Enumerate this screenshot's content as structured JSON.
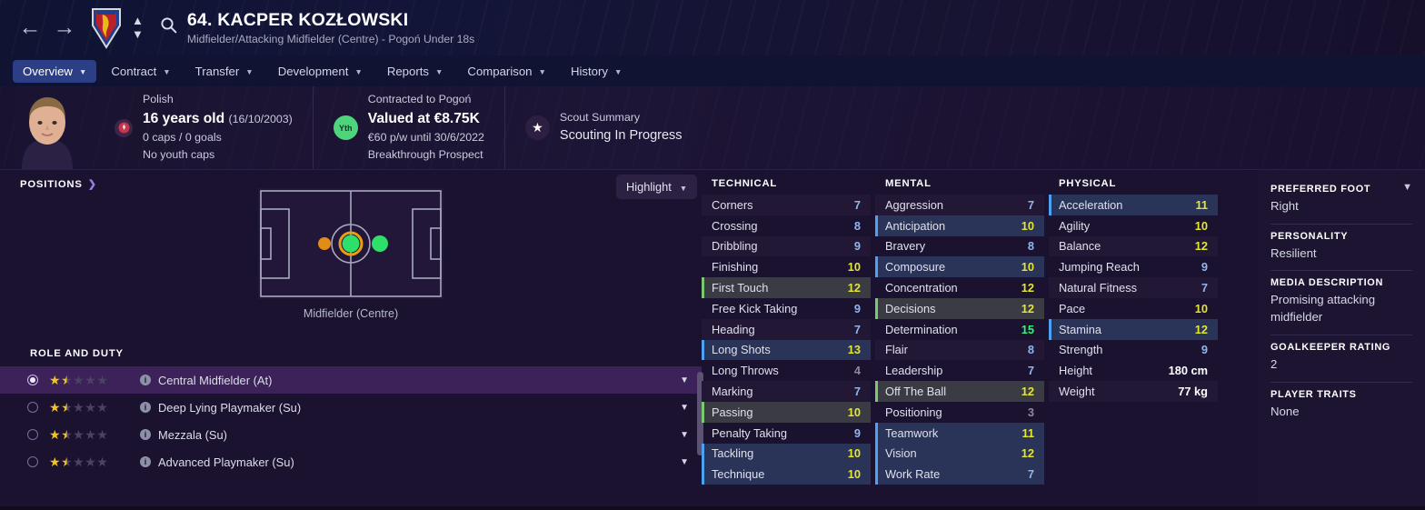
{
  "header": {
    "back_icon": "arrow-left-icon",
    "forward_icon": "arrow-right-icon",
    "club_crest": "pogon-szczecin-crest",
    "spinner_up": "chevron-up-icon",
    "spinner_down": "chevron-down-icon",
    "search_icon": "search-icon",
    "player_title": "64. KACPER KOZŁOWSKI",
    "player_subtitle": "Midfielder/Attacking Midfielder (Centre) - Pogoń Under 18s"
  },
  "tabs": [
    {
      "label": "Overview",
      "active": true
    },
    {
      "label": "Contract",
      "active": false
    },
    {
      "label": "Transfer",
      "active": false
    },
    {
      "label": "Development",
      "active": false
    },
    {
      "label": "Reports",
      "active": false
    },
    {
      "label": "Comparison",
      "active": false
    },
    {
      "label": "History",
      "active": false
    }
  ],
  "info": {
    "nationality": "Polish",
    "age": "16 years old",
    "dob": "(16/10/2003)",
    "caps": "0 caps / 0 goals",
    "youth_caps": "No youth caps",
    "contract_label": "Contracted to Pogoń",
    "value": "Valued at €8.75K",
    "wage": "€60 p/w until 30/6/2022",
    "status": "Breakthrough Prospect",
    "yth_badge": "Yth",
    "scout_label": "Scout Summary",
    "scout_value": "Scouting In Progress"
  },
  "positions": {
    "header": "POSITIONS",
    "header_arrow": "chevron-right-icon",
    "highlight_button": "Highlight",
    "pitch_caption": "Midfielder (Centre)",
    "markers": [
      {
        "name": "defensive-midfielder-marker",
        "color": "#e08c16",
        "selected": false
      },
      {
        "name": "midfielder-centre-marker",
        "color": "#2ee06a",
        "selected": true
      },
      {
        "name": "attacking-midfielder-marker",
        "color": "#2ee06a",
        "selected": false
      }
    ]
  },
  "role_and_duty": {
    "title": "ROLE AND DUTY",
    "roles": [
      {
        "name": "Central Midfielder (At)",
        "stars": 1.5,
        "selected": true
      },
      {
        "name": "Deep Lying Playmaker (Su)",
        "stars": 1.5,
        "selected": false
      },
      {
        "name": "Mezzala (Su)",
        "stars": 1.5,
        "selected": false
      },
      {
        "name": "Advanced Playmaker (Su)",
        "stars": 1.5,
        "selected": false
      }
    ]
  },
  "attributes": {
    "technical": {
      "header": "TECHNICAL",
      "rows": [
        {
          "name": "Corners",
          "value": "7",
          "tier": "mid",
          "bar": "none",
          "bg": "alt"
        },
        {
          "name": "Crossing",
          "value": "8",
          "tier": "mid",
          "bar": "none",
          "bg": "none"
        },
        {
          "name": "Dribbling",
          "value": "9",
          "tier": "mid",
          "bar": "none",
          "bg": "alt"
        },
        {
          "name": "Finishing",
          "value": "10",
          "tier": "good",
          "bar": "none",
          "bg": "none"
        },
        {
          "name": "First Touch",
          "value": "12",
          "tier": "good",
          "bar": "green",
          "bg": "grey"
        },
        {
          "name": "Free Kick Taking",
          "value": "9",
          "tier": "mid",
          "bar": "none",
          "bg": "none"
        },
        {
          "name": "Heading",
          "value": "7",
          "tier": "mid",
          "bar": "none",
          "bg": "alt"
        },
        {
          "name": "Long Shots",
          "value": "13",
          "tier": "good",
          "bar": "blue",
          "bg": "blue"
        },
        {
          "name": "Long Throws",
          "value": "4",
          "tier": "low",
          "bar": "none",
          "bg": "none"
        },
        {
          "name": "Marking",
          "value": "7",
          "tier": "mid",
          "bar": "none",
          "bg": "alt"
        },
        {
          "name": "Passing",
          "value": "10",
          "tier": "good",
          "bar": "green",
          "bg": "grey"
        },
        {
          "name": "Penalty Taking",
          "value": "9",
          "tier": "mid",
          "bar": "none",
          "bg": "none"
        },
        {
          "name": "Tackling",
          "value": "10",
          "tier": "good",
          "bar": "blue",
          "bg": "blue"
        },
        {
          "name": "Technique",
          "value": "10",
          "tier": "good",
          "bar": "blue",
          "bg": "blue"
        }
      ]
    },
    "mental": {
      "header": "MENTAL",
      "rows": [
        {
          "name": "Aggression",
          "value": "7",
          "tier": "mid",
          "bar": "none",
          "bg": "alt"
        },
        {
          "name": "Anticipation",
          "value": "10",
          "tier": "good",
          "bar": "blue",
          "bg": "blue"
        },
        {
          "name": "Bravery",
          "value": "8",
          "tier": "mid",
          "bar": "none",
          "bg": "none"
        },
        {
          "name": "Composure",
          "value": "10",
          "tier": "good",
          "bar": "blue",
          "bg": "blue"
        },
        {
          "name": "Concentration",
          "value": "12",
          "tier": "good",
          "bar": "none",
          "bg": "none"
        },
        {
          "name": "Decisions",
          "value": "12",
          "tier": "good",
          "bar": "green",
          "bg": "grey"
        },
        {
          "name": "Determination",
          "value": "15",
          "tier": "hi",
          "bar": "none",
          "bg": "none"
        },
        {
          "name": "Flair",
          "value": "8",
          "tier": "mid",
          "bar": "none",
          "bg": "alt"
        },
        {
          "name": "Leadership",
          "value": "7",
          "tier": "mid",
          "bar": "none",
          "bg": "none"
        },
        {
          "name": "Off The Ball",
          "value": "12",
          "tier": "good",
          "bar": "green",
          "bg": "grey"
        },
        {
          "name": "Positioning",
          "value": "3",
          "tier": "low",
          "bar": "none",
          "bg": "none"
        },
        {
          "name": "Teamwork",
          "value": "11",
          "tier": "good",
          "bar": "blue",
          "bg": "blue"
        },
        {
          "name": "Vision",
          "value": "12",
          "tier": "good",
          "bar": "blue",
          "bg": "blue"
        },
        {
          "name": "Work Rate",
          "value": "7",
          "tier": "mid",
          "bar": "blue",
          "bg": "blue"
        }
      ]
    },
    "physical": {
      "header": "PHYSICAL",
      "rows": [
        {
          "name": "Acceleration",
          "value": "11",
          "tier": "good",
          "bar": "blue",
          "bg": "blue"
        },
        {
          "name": "Agility",
          "value": "10",
          "tier": "good",
          "bar": "none",
          "bg": "none"
        },
        {
          "name": "Balance",
          "value": "12",
          "tier": "good",
          "bar": "none",
          "bg": "alt"
        },
        {
          "name": "Jumping Reach",
          "value": "9",
          "tier": "mid",
          "bar": "none",
          "bg": "none"
        },
        {
          "name": "Natural Fitness",
          "value": "7",
          "tier": "mid",
          "bar": "none",
          "bg": "alt"
        },
        {
          "name": "Pace",
          "value": "10",
          "tier": "good",
          "bar": "none",
          "bg": "none"
        },
        {
          "name": "Stamina",
          "value": "12",
          "tier": "good",
          "bar": "blue",
          "bg": "blue"
        },
        {
          "name": "Strength",
          "value": "9",
          "tier": "mid",
          "bar": "none",
          "bg": "none"
        },
        {
          "name": "Height",
          "value": "180 cm",
          "tier": "plain",
          "bar": "none",
          "bg": "none"
        },
        {
          "name": "Weight",
          "value": "77 kg",
          "tier": "plain",
          "bar": "none",
          "bg": "alt"
        }
      ]
    }
  },
  "sidebar": {
    "preferred_foot_label": "PREFERRED FOOT",
    "preferred_foot_value": "Right",
    "personality_label": "PERSONALITY",
    "personality_value": "Resilient",
    "media_label": "MEDIA DESCRIPTION",
    "media_value": "Promising attacking midfielder",
    "gk_label": "GOALKEEPER RATING",
    "gk_value": "2",
    "traits_label": "PLAYER TRAITS",
    "traits_value": "None",
    "expand_icon": "chevron-down-icon"
  },
  "colors": {
    "accent_tab": "#2b3e86",
    "selected_role": "#3c2259",
    "value_high": "#3cf07d",
    "value_good": "#e3e732",
    "value_mid": "#8fb6ee",
    "value_low": "#8b8aa0",
    "bar_blue": "#4ea0f0",
    "bar_green": "#7bc96f"
  }
}
